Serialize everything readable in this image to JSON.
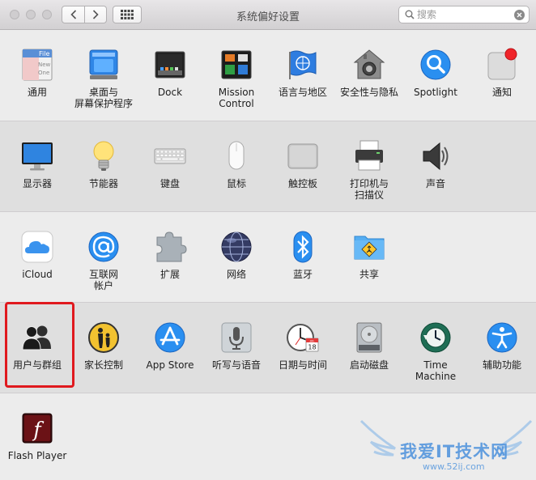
{
  "window": {
    "title": "系统偏好设置"
  },
  "search": {
    "placeholder": "搜索",
    "value": ""
  },
  "sections": [
    [
      {
        "id": "general",
        "label": "通用",
        "icon": "general-icon"
      },
      {
        "id": "desktop",
        "label": "桌面与\n屏幕保护程序",
        "icon": "desktop-screensaver-icon"
      },
      {
        "id": "dock",
        "label": "Dock",
        "icon": "dock-icon"
      },
      {
        "id": "mission",
        "label": "Mission\nControl",
        "icon": "mission-control-icon"
      },
      {
        "id": "language",
        "label": "语言与地区",
        "icon": "language-region-icon"
      },
      {
        "id": "security",
        "label": "安全性与隐私",
        "icon": "security-privacy-icon"
      },
      {
        "id": "spotlight",
        "label": "Spotlight",
        "icon": "spotlight-icon"
      },
      {
        "id": "notifications",
        "label": "通知",
        "icon": "notifications-icon"
      }
    ],
    [
      {
        "id": "displays",
        "label": "显示器",
        "icon": "displays-icon"
      },
      {
        "id": "energy",
        "label": "节能器",
        "icon": "energy-saver-icon"
      },
      {
        "id": "keyboard",
        "label": "键盘",
        "icon": "keyboard-icon"
      },
      {
        "id": "mouse",
        "label": "鼠标",
        "icon": "mouse-icon"
      },
      {
        "id": "trackpad",
        "label": "触控板",
        "icon": "trackpad-icon"
      },
      {
        "id": "printers",
        "label": "打印机与\n扫描仪",
        "icon": "printer-scanner-icon"
      },
      {
        "id": "sound",
        "label": "声音",
        "icon": "sound-icon"
      }
    ],
    [
      {
        "id": "icloud",
        "label": "iCloud",
        "icon": "icloud-icon"
      },
      {
        "id": "internet",
        "label": "互联网\n帐户",
        "icon": "internet-accounts-icon"
      },
      {
        "id": "extensions",
        "label": "扩展",
        "icon": "extensions-icon"
      },
      {
        "id": "network",
        "label": "网络",
        "icon": "network-icon"
      },
      {
        "id": "bluetooth",
        "label": "蓝牙",
        "icon": "bluetooth-icon"
      },
      {
        "id": "sharing",
        "label": "共享",
        "icon": "sharing-icon"
      }
    ],
    [
      {
        "id": "users",
        "label": "用户与群组",
        "icon": "users-groups-icon"
      },
      {
        "id": "parental",
        "label": "家长控制",
        "icon": "parental-controls-icon"
      },
      {
        "id": "appstore",
        "label": "App Store",
        "icon": "app-store-icon"
      },
      {
        "id": "dictation",
        "label": "听写与语音",
        "icon": "dictation-speech-icon"
      },
      {
        "id": "datetime",
        "label": "日期与时间",
        "icon": "date-time-icon"
      },
      {
        "id": "startup",
        "label": "启动磁盘",
        "icon": "startup-disk-icon"
      },
      {
        "id": "timemachine",
        "label": "Time Machine",
        "icon": "time-machine-icon"
      },
      {
        "id": "accessibility",
        "label": "辅助功能",
        "icon": "accessibility-icon"
      }
    ],
    [
      {
        "id": "flash",
        "label": "Flash Player",
        "icon": "flash-player-icon"
      }
    ]
  ],
  "icon_text": {
    "general_file": "File",
    "general_new": "New",
    "general_one": "One",
    "calendar_month": "JUL",
    "calendar_day": "18",
    "flash_glyph": "f"
  },
  "watermark": {
    "brand": "我爱IT技术网",
    "url": "www.52ij.com"
  },
  "colors": {
    "highlight": "#e0191e",
    "accent_blue": "#1e8ef0"
  }
}
